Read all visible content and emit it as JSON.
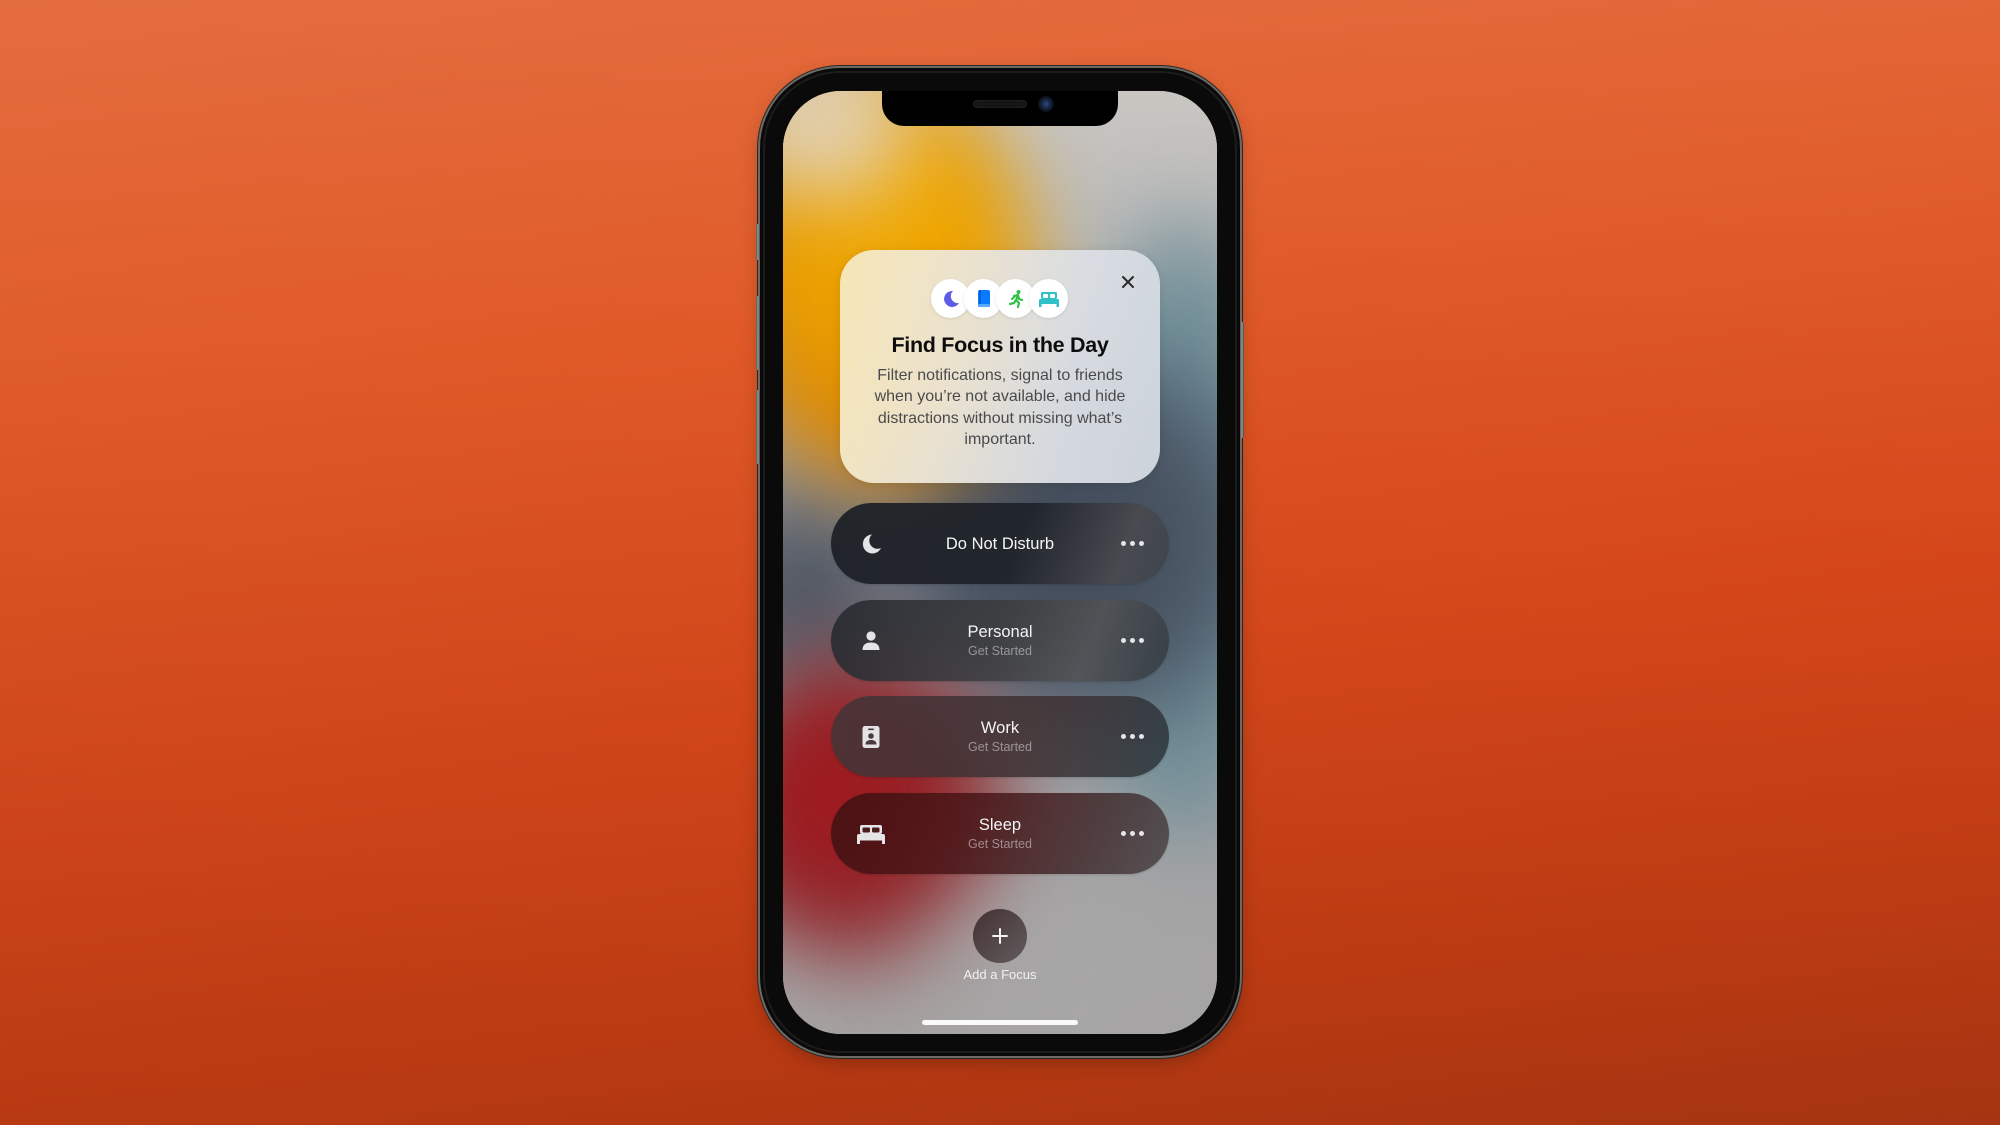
{
  "colors": {
    "background_top": "#e46b3c",
    "background_bottom": "#ab3612",
    "icon_moon": "#5e5ce6",
    "icon_book": "#0a7aff",
    "icon_fitness": "#30c048",
    "icon_bed": "#30c0c8"
  },
  "intro_card": {
    "icons": [
      "moon-icon",
      "book-icon",
      "running-figure-icon",
      "bed-icon"
    ],
    "title": "Find Focus in the Day",
    "body": "Filter notifications, signal to friends when you’re not available, and hide distractions without missing what’s important.",
    "close_icon": "close-icon"
  },
  "focus_modes": [
    {
      "icon": "moon-icon",
      "title": "Do Not Disturb",
      "subtitle": null,
      "more_icon": "ellipsis-icon"
    },
    {
      "icon": "person-icon",
      "title": "Personal",
      "subtitle": "Get Started",
      "more_icon": "ellipsis-icon"
    },
    {
      "icon": "id-badge-icon",
      "title": "Work",
      "subtitle": "Get Started",
      "more_icon": "ellipsis-icon"
    },
    {
      "icon": "bed-icon",
      "title": "Sleep",
      "subtitle": "Get Started",
      "more_icon": "ellipsis-icon"
    }
  ],
  "add_focus": {
    "icon": "plus-icon",
    "label": "Add a Focus"
  }
}
